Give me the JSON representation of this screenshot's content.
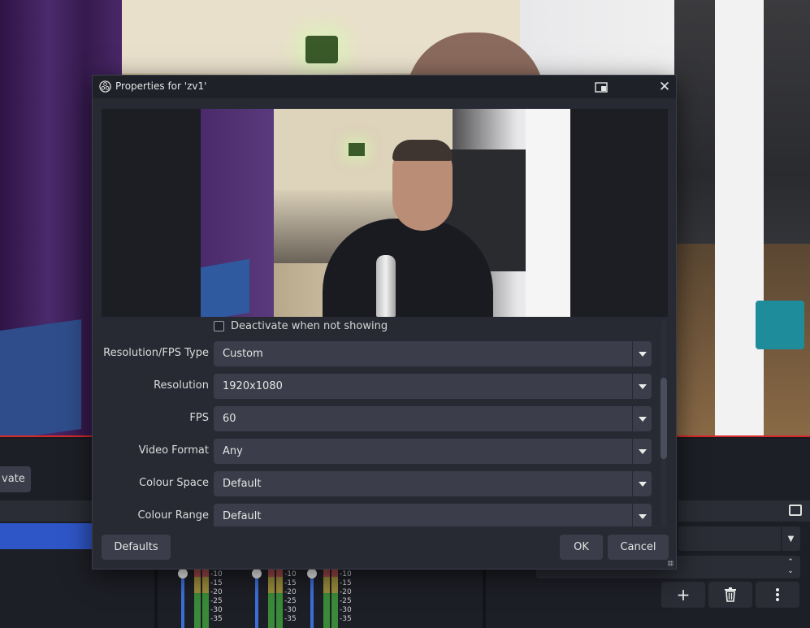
{
  "dialog": {
    "title": "Properties for 'zv1'",
    "deactivate_label": "Deactivate when not showing",
    "deactivate_checked": false,
    "fields": [
      {
        "label": "Resolution/FPS Type",
        "value": "Custom"
      },
      {
        "label": "Resolution",
        "value": "1920x1080"
      },
      {
        "label": "FPS",
        "value": "60"
      },
      {
        "label": "Video Format",
        "value": "Any"
      },
      {
        "label": "Colour Space",
        "value": "Default"
      },
      {
        "label": "Colour Range",
        "value": "Default"
      }
    ],
    "defaults_label": "Defaults",
    "ok_label": "OK",
    "cancel_label": "Cancel"
  },
  "background": {
    "activate_label": "vate",
    "mixer_scale": [
      "-10",
      "-15",
      "-20",
      "-25",
      "-30",
      "-35"
    ],
    "add_icon": "plus-icon",
    "remove_icon": "trash-icon",
    "more_icon": "kebab-icon"
  },
  "colors": {
    "dialog_bg": "#272a33",
    "control_bg": "#3b3e4a",
    "selection_blue": "#2f56c6",
    "preview_border_red": "#d62a2a"
  }
}
